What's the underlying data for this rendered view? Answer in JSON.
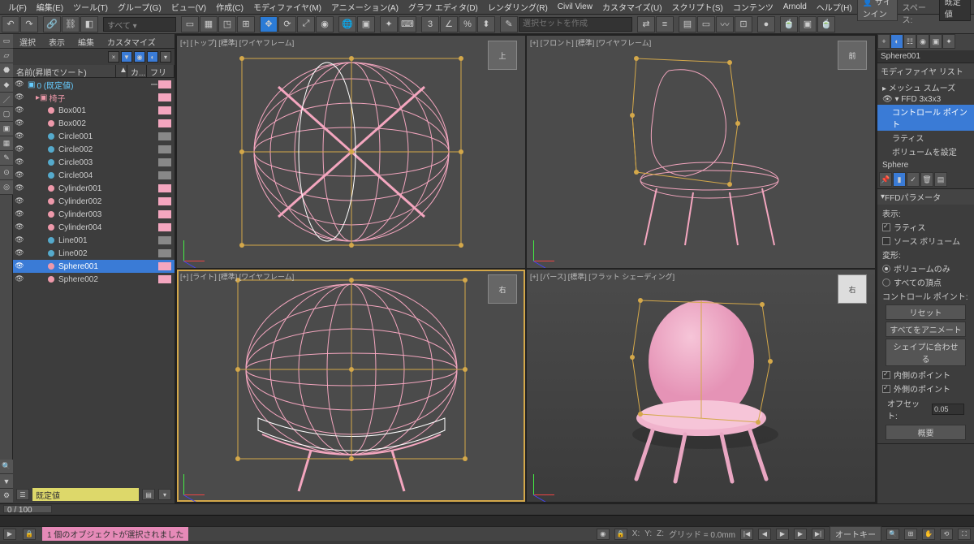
{
  "menubar": {
    "items": [
      "ル(F)",
      "編集(E)",
      "ツール(T)",
      "グループ(G)",
      "ビュー(V)",
      "作成(C)",
      "モディファイヤ(M)",
      "アニメーション(A)",
      "グラフ エディタ(D)",
      "レンダリング(R)",
      "Civil View",
      "カスタマイズ(U)",
      "スクリプト(S)",
      "コンテンツ",
      "Arnold",
      "ヘルプ(H)"
    ],
    "signin": "サインイン",
    "ws_label": "ワークスペース:",
    "ws_value": "既定値"
  },
  "toolbar": {
    "dropdown": "すべて ▾",
    "search_placeholder": "選択セットを作成"
  },
  "scene": {
    "tabs": [
      "選択",
      "表示",
      "編集",
      "カスタマイズ"
    ],
    "header": {
      "name": "名前(昇順でソート)",
      "col2": "▲",
      "col3": "カ...",
      "col4": "フリーズ"
    },
    "root": {
      "label": "0 (既定値)"
    },
    "group": {
      "label": "椅子"
    },
    "items": [
      {
        "label": "Box001",
        "sw": "sw-pink"
      },
      {
        "label": "Box002",
        "sw": "sw-pink"
      },
      {
        "label": "Circle001",
        "sw": "sw-gray"
      },
      {
        "label": "Circle002",
        "sw": "sw-gray"
      },
      {
        "label": "Circle003",
        "sw": "sw-gray"
      },
      {
        "label": "Circle004",
        "sw": "sw-gray"
      },
      {
        "label": "Cylinder001",
        "sw": "sw-pink"
      },
      {
        "label": "Cylinder002",
        "sw": "sw-pink"
      },
      {
        "label": "Cylinder003",
        "sw": "sw-pink"
      },
      {
        "label": "Cylinder004",
        "sw": "sw-pink"
      },
      {
        "label": "Line001",
        "sw": "sw-gray"
      },
      {
        "label": "Line002",
        "sw": "sw-gray"
      },
      {
        "label": "Sphere001",
        "sw": "sw-pink",
        "sel": true
      },
      {
        "label": "Sphere002",
        "sw": "sw-pink"
      }
    ],
    "foot_field": "既定値"
  },
  "viewports": {
    "tl": {
      "label": "[+] [トップ] [標準] [ワイヤフレーム]",
      "cube": "上"
    },
    "tr": {
      "label": "[+] [フロント] [標準] [ワイヤフレーム]",
      "cube": "前"
    },
    "bl": {
      "label": "[+] [ライト] [標準] [ワイヤフレーム]",
      "cube": "右"
    },
    "br": {
      "label": "[+] [パース] [標準] [フラット シェーディング]",
      "cube": "右"
    }
  },
  "modify": {
    "obj_name": "Sphere001",
    "list_title": "モディファイヤ リスト",
    "stack": [
      {
        "label": "▸ メッシュ スムーズ"
      },
      {
        "label": "▾ FFD 3x3x3",
        "exp": true
      },
      {
        "label": "コントロール ポイント",
        "sel": true,
        "indent": true
      },
      {
        "label": "ラティス",
        "indent": true
      },
      {
        "label": "ボリュームを設定",
        "indent": true
      }
    ],
    "base": "Sphere",
    "sec_title": "FFDパラメータ",
    "display_label": "表示:",
    "chk_lattice": "ラティス",
    "chk_source": "ソース ボリューム",
    "deform_label": "変形:",
    "radio_vol": "ボリュームのみ",
    "radio_all": "すべての頂点",
    "cp_label": "コントロール ポイント:",
    "btn_reset": "リセット",
    "btn_anim": "すべてをアニメート",
    "btn_fit": "シェイプに合わせる",
    "chk_inside": "内側のポイント",
    "chk_outside": "外側のポイント",
    "offset_label": "オフセット:",
    "offset_val": "0.05",
    "btn_outline": "概要"
  },
  "time": {
    "slider": "0 / 100"
  },
  "status": {
    "msg": "1 個のオブジェクトが選択されました",
    "x": "X:",
    "y": "Y:",
    "z": "Z:",
    "grid": "グリッド = 0.0mm",
    "autokey": "オートキー"
  }
}
